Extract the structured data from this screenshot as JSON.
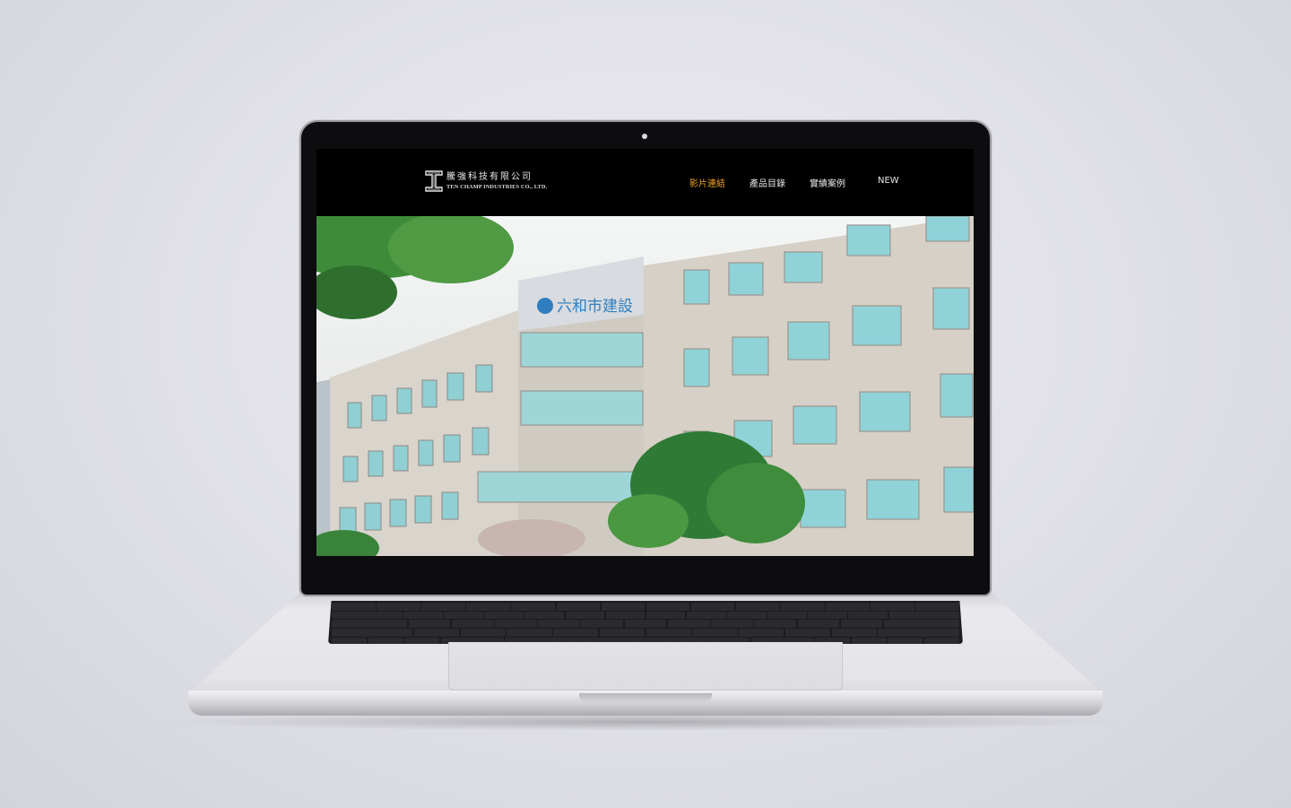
{
  "site": {
    "logo_cn": "騰強科技有限公司",
    "logo_en": "TEN CHAMP INDUSTRIES CO., LTD.",
    "logo_icon": "i-beam-logo-icon"
  },
  "nav": [
    {
      "label": "影片連結",
      "active": true
    },
    {
      "label": "產品目錄",
      "active": false
    },
    {
      "label": "實績案例",
      "active": false
    },
    {
      "label": "NEW",
      "active": false
    }
  ],
  "hero": {
    "building_sign": "六和市建設",
    "slide_count": 3,
    "active_slide": 1
  },
  "colors": {
    "header_bg": "#000000",
    "nav_text": "#e6e6e6",
    "nav_active": "#f0a22a"
  }
}
